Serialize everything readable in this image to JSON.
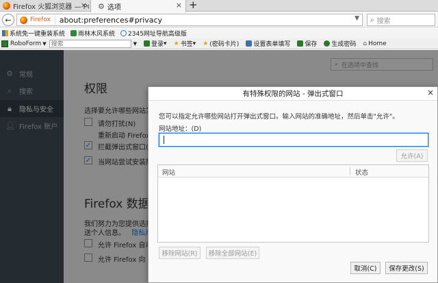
{
  "tabs": [
    {
      "title": "Firefox 火狐浏览器 — PC/Android",
      "active": false
    },
    {
      "title": "选项",
      "active": true
    }
  ],
  "navbar": {
    "identity_label": "Firefox",
    "url": "about:preferences#privacy",
    "search_placeholder": "搜索"
  },
  "bookmarks": [
    {
      "label": "系统免一键重装系统",
      "icon": "windows-icon"
    },
    {
      "label": "雨林木风系统",
      "icon": "tree-icon"
    },
    {
      "label": "2345网址导航高级版",
      "icon": "globe-icon"
    }
  ],
  "roboform": {
    "label": "RoboForm",
    "search_placeholder": "搜索",
    "items": [
      {
        "label": "登录",
        "icon": "login-icon",
        "color": "#2a7a2a"
      },
      {
        "label": "书签",
        "icon": "star-icon",
        "color": "#e0a800"
      },
      {
        "label": "(密码卡片)",
        "icon": "star-icon",
        "color": "#e0a800"
      },
      {
        "label": "设置表单填写",
        "icon": "form-icon",
        "color": "#3b6fb6"
      },
      {
        "label": "保存",
        "icon": "save-icon",
        "color": "#2a7a2a"
      },
      {
        "label": "生成密码",
        "icon": "key-icon",
        "color": "#2a7a2a"
      },
      {
        "label": "Home",
        "icon": "home-icon",
        "color": "#555555"
      }
    ]
  },
  "sidebar": {
    "items": [
      {
        "label": "常规",
        "icon": "gear-icon",
        "active": false
      },
      {
        "label": "搜索",
        "icon": "search-icon",
        "active": false
      },
      {
        "label": "隐私与安全",
        "icon": "lock-icon",
        "active": true
      },
      {
        "label": "Firefox 账户",
        "icon": "user-icon",
        "active": false
      }
    ]
  },
  "prefs": {
    "find_placeholder": "在选项中查找",
    "permissions_heading": "权限",
    "permissions_intro": "选择要允许哪些网站发",
    "options": [
      {
        "label": "请勿打扰(N)",
        "checked": false
      },
      {
        "label": "重新启动 Firefox",
        "checked": false
      },
      {
        "label": "拦截弹出式窗口(B",
        "checked": true
      },
      {
        "label": "当网站尝试安装附",
        "checked": true
      }
    ],
    "data_heading": "Firefox 数据收",
    "data_intro_1": "我们努力为您提供选择",
    "data_intro_2": "送个人信息。",
    "privacy_link": "隐私声",
    "data_options": [
      {
        "label": "允许 Firefox 自动",
        "checked": false
      },
      {
        "label": "允许 Firefox 向 M",
        "checked": false
      }
    ]
  },
  "dialog": {
    "title": "有特殊权限的网站 - 弹出式窗口",
    "description": "您可以指定允许哪些网站打开弹出式窗口。输入网站的准确地址，然后单击\"允许\"。",
    "address_label": "网站地址：(D)",
    "address_value": "",
    "allow_button": "允许(A)",
    "columns": [
      "网站",
      "状态"
    ],
    "rows": [],
    "remove_button": "移除网站(R)",
    "remove_all_button": "移除全部网站(E)",
    "cancel_button": "取消(C)",
    "save_button": "保存更改(S)"
  }
}
